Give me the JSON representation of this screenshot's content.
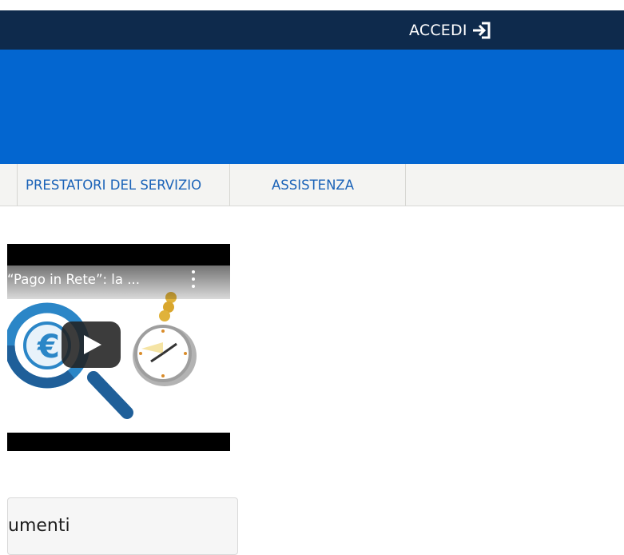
{
  "header": {
    "login_label": "ACCEDI",
    "login_icon": "sign-in-icon"
  },
  "nav": {
    "items": [
      {
        "label": "PRESTATORI DEL SERVIZIO"
      },
      {
        "label": "ASSISTENZA"
      }
    ]
  },
  "video": {
    "title": "“Pago in Rete”: la ...",
    "menu_icon": "kebab-menu-icon",
    "play_icon": "play-icon",
    "thumbnail_icons": [
      "euro-magnifier-icon",
      "clock-icon"
    ]
  },
  "card": {
    "title": "umenti"
  },
  "colors": {
    "topbar": "#0e2a4c",
    "hero": "#0366d0",
    "nav_text": "#1b63b8",
    "nav_bg": "#f4f4f2"
  }
}
